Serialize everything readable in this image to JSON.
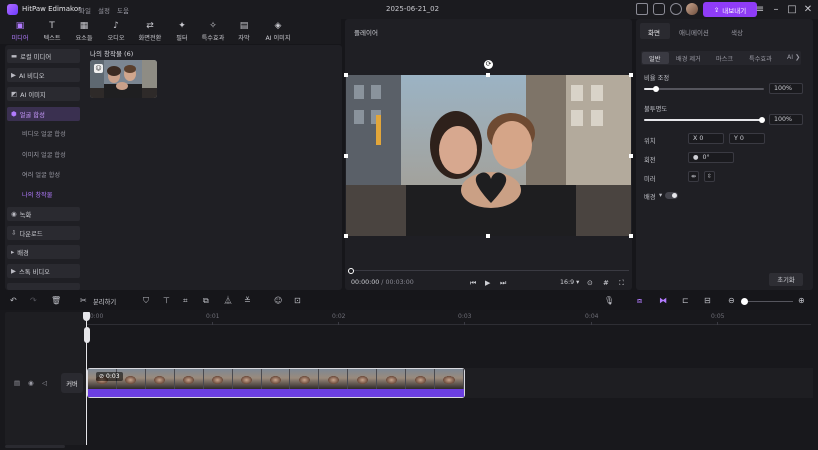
{
  "app": {
    "name": "HitPaw Edimakor",
    "menus": [
      "파일",
      "설정",
      "도움"
    ],
    "project_title": "2025-06-21_02",
    "export_label": "내보내기",
    "accent_color": "#8f3cf7"
  },
  "tools": [
    {
      "label": "미디어",
      "icon": "media-icon"
    },
    {
      "label": "텍스트",
      "icon": "text-icon"
    },
    {
      "label": "요소들",
      "icon": "elements-icon"
    },
    {
      "label": "오디오",
      "icon": "audio-icon"
    },
    {
      "label": "화면전환",
      "icon": "transition-icon"
    },
    {
      "label": "필터",
      "icon": "filter-icon"
    },
    {
      "label": "특수효과",
      "icon": "effects-icon"
    },
    {
      "label": "자막",
      "icon": "subtitle-icon"
    },
    {
      "label": "AI 이미지",
      "icon": "ai-image-icon"
    }
  ],
  "sidebar": {
    "items": [
      {
        "label": "로컬 미디어",
        "icon": "folder-icon"
      },
      {
        "label": "AI 비디오",
        "icon": "ai-video-icon"
      },
      {
        "label": "AI 이미지",
        "icon": "ai-image-icon"
      },
      {
        "label": "얼굴 합성",
        "icon": "face-swap-icon"
      },
      {
        "label": "녹화",
        "icon": "record-icon"
      },
      {
        "label": "다운로드",
        "icon": "download-icon"
      },
      {
        "label": "배경",
        "icon": "background-icon"
      },
      {
        "label": "스톡 비디오",
        "icon": "stock-video-icon"
      }
    ],
    "subitems": [
      "비디오 얼굴 합성",
      "이미지 얼굴 합성",
      "여러 얼굴 합성",
      "나의 창작물"
    ]
  },
  "media": {
    "title": "나의 창작물 (6)"
  },
  "player": {
    "title": "플레이어",
    "current_time": "00:00:00",
    "separator": "/",
    "total_time": "00:03:00",
    "ratio": "16:9"
  },
  "right_panel": {
    "tabs": [
      "화면",
      "애니메이션",
      "색상"
    ],
    "subtabs": [
      "일반",
      "배경 제거",
      "마스크",
      "특수효과",
      "AI"
    ],
    "scale_label": "비율 조정",
    "scale_value": "100%",
    "scale_fraction": 1.0,
    "opacity_label": "불투명도",
    "opacity_value": "100%",
    "opacity_fraction": 1.0,
    "position_label": "위치",
    "pos_x_label": "X",
    "pos_x_value": "0",
    "pos_y_label": "Y",
    "pos_y_value": "0",
    "rotation_label": "회전",
    "rotation_value": "0°",
    "mirror_label": "미러",
    "speed_label": "배경",
    "reset_label": "초기화"
  },
  "timeline": {
    "split_label": "분리하기",
    "ticks": [
      "00:00",
      "0:01",
      "0:02",
      "0:03",
      "0:04",
      "0:05"
    ],
    "cover_label": "커버",
    "clip_label": "0:03"
  }
}
